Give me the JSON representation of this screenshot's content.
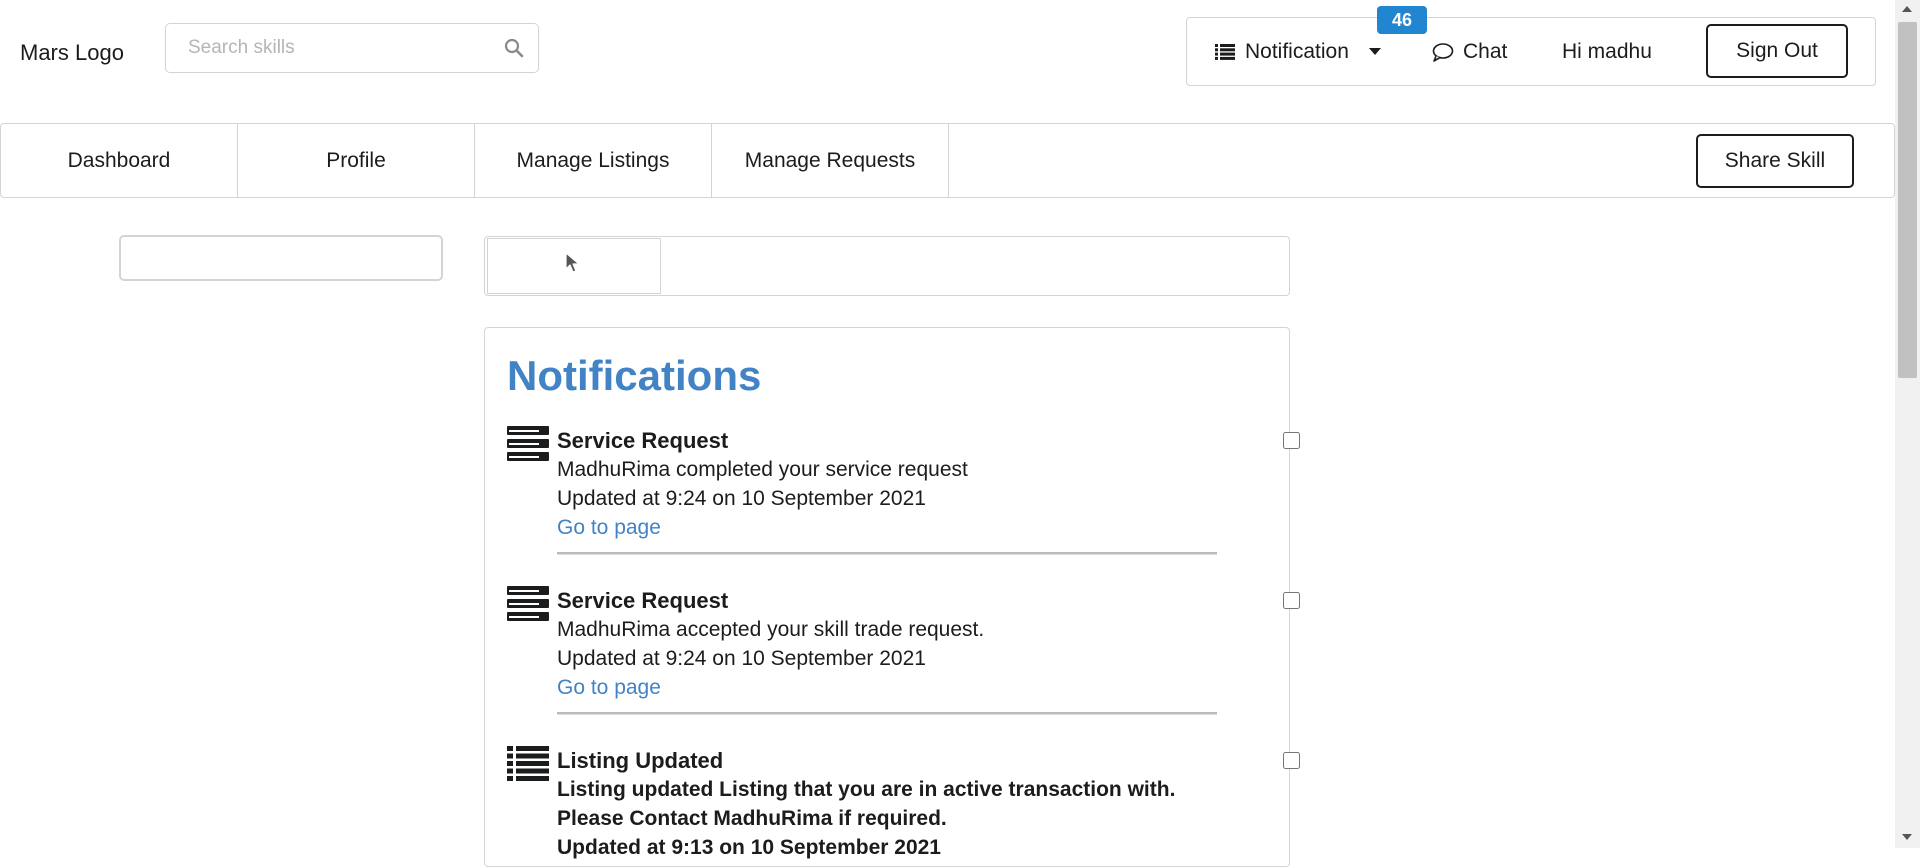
{
  "header": {
    "logo": "Mars Logo",
    "search_placeholder": "Search skills",
    "notification_label": "Notification",
    "notification_count": "46",
    "chat_label": "Chat",
    "greeting": "Hi madhu",
    "signout_label": "Sign Out"
  },
  "nav": {
    "tabs": [
      "Dashboard",
      "Profile",
      "Manage Listings",
      "Manage Requests"
    ],
    "share_label": "Share Skill"
  },
  "panel": {
    "title": "Notifications",
    "notifications": [
      {
        "icon": "server-icon",
        "title": "Service Request",
        "message": "MadhuRima completed your service request",
        "updated": "Updated at 9:24 on 10 September 2021",
        "link": "Go to page",
        "checked": false
      },
      {
        "icon": "server-icon",
        "title": "Service Request",
        "message": "MadhuRima accepted your skill trade request.",
        "updated": "Updated at 9:24 on 10 September 2021",
        "link": "Go to page",
        "checked": false
      },
      {
        "icon": "list-icon",
        "title": "Listing Updated",
        "message": "Listing updated Listing that you are in active transaction with. Please Contact MadhuRima if required.",
        "updated": "Updated at 9:13 on 10 September 2021",
        "checked": false
      }
    ]
  },
  "colors": {
    "accent": "#4183c4",
    "badge": "#2185d0",
    "border": "#d4d4d5",
    "text": "#1b1c1d"
  }
}
